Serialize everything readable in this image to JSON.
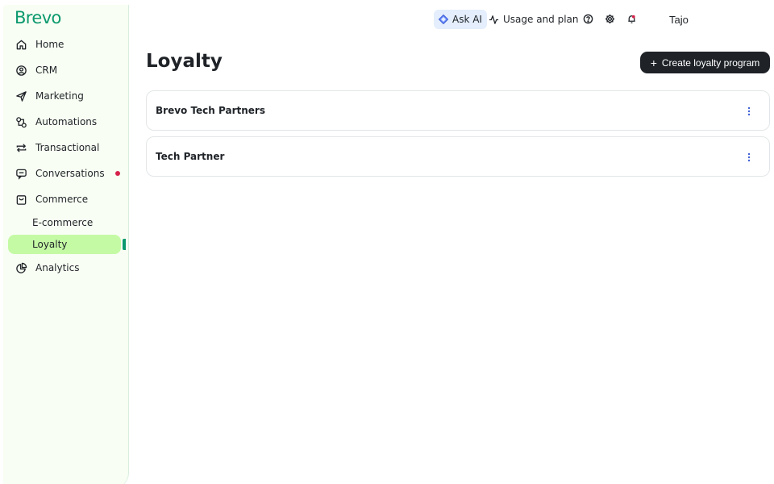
{
  "app": {
    "logo": "Brevo"
  },
  "sidebar": {
    "items": [
      {
        "label": "Home",
        "icon": "home-icon"
      },
      {
        "label": "CRM",
        "icon": "contacts-icon"
      },
      {
        "label": "Marketing",
        "icon": "send-icon"
      },
      {
        "label": "Automations",
        "icon": "automation-icon"
      },
      {
        "label": "Transactional",
        "icon": "repeat-icon"
      },
      {
        "label": "Conversations",
        "icon": "chat-icon",
        "badge_color": "#d6224b"
      },
      {
        "label": "Commerce",
        "icon": "shopping-bag-icon"
      },
      {
        "label": "Analytics",
        "icon": "pie-chart-icon"
      }
    ],
    "sub_items": [
      {
        "label": "E-commerce"
      },
      {
        "label": "Loyalty",
        "active": true
      }
    ]
  },
  "topbar": {
    "ask_ai": "Ask AI",
    "usage": "Usage and plan",
    "user": "Tajo",
    "icons": [
      "help-icon",
      "settings-icon",
      "bell-icon"
    ]
  },
  "main": {
    "title": "Loyalty",
    "create_button": "Create loyalty program",
    "programs": [
      {
        "name": "Brevo Tech Partners"
      },
      {
        "name": "Tech Partner"
      }
    ]
  },
  "colors": {
    "brand": "#0b996e",
    "active_bg": "#c5faa5",
    "sidebar_bg": "#f8fef3",
    "button_bg": "#1f2328",
    "ask_ai_bg": "#e4eefc",
    "notification": "#d6224b"
  }
}
